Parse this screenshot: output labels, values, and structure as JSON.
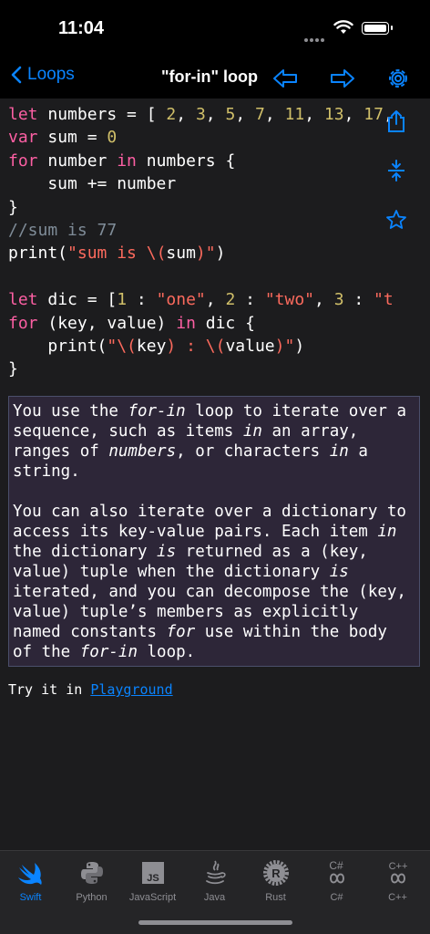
{
  "status": {
    "time": "11:04"
  },
  "nav": {
    "back_label": "Loops",
    "title": "\"for-in\" loop"
  },
  "code_lines": [
    [
      [
        "kw",
        "let"
      ],
      [
        "t",
        " numbers = [ "
      ],
      [
        "num",
        "2"
      ],
      [
        "t",
        ", "
      ],
      [
        "num",
        "3"
      ],
      [
        "t",
        ", "
      ],
      [
        "num",
        "5"
      ],
      [
        "t",
        ", "
      ],
      [
        "num",
        "7"
      ],
      [
        "t",
        ", "
      ],
      [
        "num",
        "11"
      ],
      [
        "t",
        ", "
      ],
      [
        "num",
        "13"
      ],
      [
        "t",
        ", "
      ],
      [
        "num",
        "17"
      ],
      [
        "t",
        ","
      ]
    ],
    [
      [
        "kw",
        "var"
      ],
      [
        "t",
        " sum = "
      ],
      [
        "num",
        "0"
      ]
    ],
    [
      [
        "kw",
        "for"
      ],
      [
        "t",
        " number "
      ],
      [
        "kw",
        "in"
      ],
      [
        "t",
        " numbers {"
      ]
    ],
    [
      [
        "t",
        "    sum += number"
      ]
    ],
    [
      [
        "t",
        "}"
      ]
    ],
    [
      [
        "cm",
        "//sum is 77"
      ]
    ],
    [
      [
        "t",
        "print("
      ],
      [
        "str",
        "\"sum is \\("
      ],
      [
        "t",
        "sum"
      ],
      [
        "str",
        ")\""
      ],
      [
        "t",
        ")"
      ]
    ],
    [
      [
        "t",
        ""
      ]
    ],
    [
      [
        "kw",
        "let"
      ],
      [
        "t",
        " dic = ["
      ],
      [
        "num",
        "1"
      ],
      [
        "t",
        " : "
      ],
      [
        "str",
        "\"one\""
      ],
      [
        "t",
        ", "
      ],
      [
        "num",
        "2"
      ],
      [
        "t",
        " : "
      ],
      [
        "str",
        "\"two\""
      ],
      [
        "t",
        ", "
      ],
      [
        "num",
        "3"
      ],
      [
        "t",
        " : "
      ],
      [
        "str",
        "\"t"
      ]
    ],
    [
      [
        "kw",
        "for"
      ],
      [
        "t",
        " (key, value) "
      ],
      [
        "kw",
        "in"
      ],
      [
        "t",
        " dic {"
      ]
    ],
    [
      [
        "t",
        "    print("
      ],
      [
        "str",
        "\"\\("
      ],
      [
        "t",
        "key"
      ],
      [
        "str",
        ") : \\("
      ],
      [
        "t",
        "value"
      ],
      [
        "str",
        ")\""
      ],
      [
        "t",
        ")"
      ]
    ],
    [
      [
        "t",
        "}"
      ]
    ]
  ],
  "description": {
    "p1": [
      [
        "t",
        "You use the "
      ],
      [
        "em",
        "for-in"
      ],
      [
        "t",
        " loop to iterate over a sequence, such as items "
      ],
      [
        "em",
        "in"
      ],
      [
        "t",
        " an array, ranges of "
      ],
      [
        "em",
        "numbers"
      ],
      [
        "t",
        ", or characters "
      ],
      [
        "em",
        "in"
      ],
      [
        "t",
        " a string."
      ]
    ],
    "p2": [
      [
        "t",
        "You can also iterate over a dictionary to access its key-value pairs. Each item "
      ],
      [
        "em",
        "in"
      ],
      [
        "t",
        " the dictionary "
      ],
      [
        "em",
        "is"
      ],
      [
        "t",
        " returned as a (key, value) tuple when the dictionary "
      ],
      [
        "em",
        "is"
      ],
      [
        "t",
        " iterated, and you can decompose the (key, value) tuple’s members as explicitly named constants "
      ],
      [
        "em",
        "for"
      ],
      [
        "t",
        " use within the body of the "
      ],
      [
        "em",
        "for-in"
      ],
      [
        "t",
        " loop."
      ]
    ]
  },
  "try_it": {
    "prefix": "Try it in ",
    "link": "Playground"
  },
  "tabs": [
    {
      "label": "Swift",
      "icon": "swift-icon",
      "active": true
    },
    {
      "label": "Python",
      "icon": "python-icon",
      "active": false
    },
    {
      "label": "JavaScript",
      "icon": "javascript-icon",
      "active": false
    },
    {
      "label": "Java",
      "icon": "java-icon",
      "active": false
    },
    {
      "label": "Rust",
      "icon": "rust-icon",
      "active": false
    },
    {
      "label": "C#",
      "icon": "csharp-icon",
      "active": false
    },
    {
      "label": "C++",
      "icon": "cplusplus-icon",
      "active": false
    }
  ],
  "colors": {
    "accent": "#0a84ff",
    "keyword": "#fc5fa3",
    "number": "#d0bf69",
    "string": "#fc6a5d",
    "comment": "#7f8c98",
    "desc_bg": "#2d2638"
  }
}
